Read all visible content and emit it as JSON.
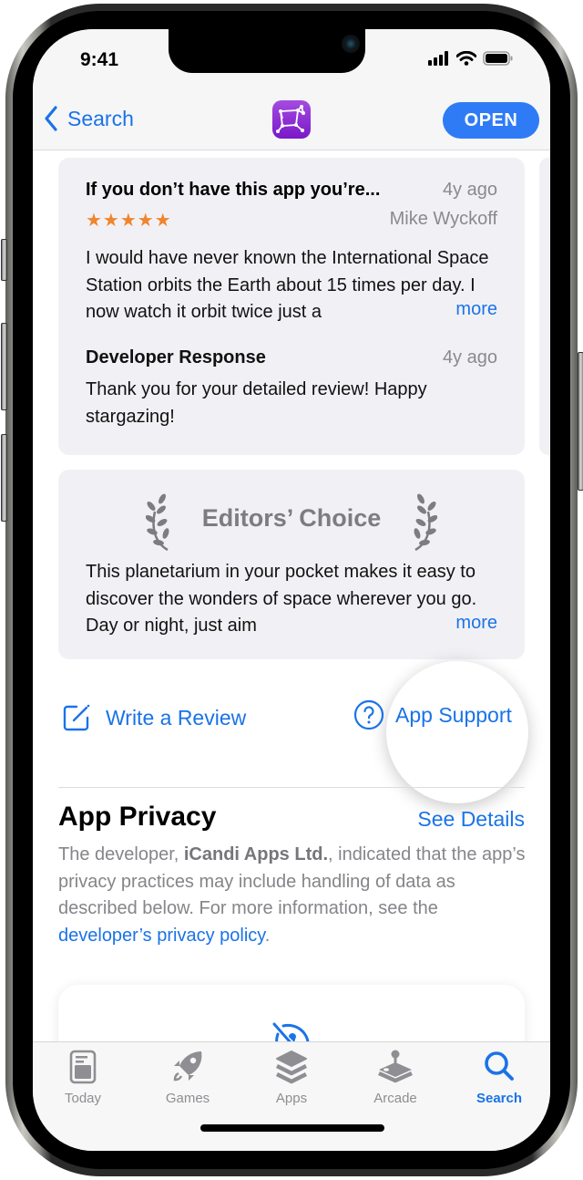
{
  "status_bar": {
    "time": "9:41"
  },
  "nav": {
    "back_label": "Search",
    "app_icon": "sky-guide-constellation-icon",
    "open_label": "OPEN",
    "accent": "#1a73e8",
    "open_color": "#2f7bf5"
  },
  "review": {
    "title": "If you don’t have this app you’re...",
    "date": "4y ago",
    "stars": "★★★★★",
    "rating": 5,
    "author": "Mike Wyckoff",
    "body": "I would have never known the International Space Station orbits the Earth about 15 times per day. I now watch it orbit twice just a",
    "more": "more",
    "developer_response": {
      "title": "Developer Response",
      "date": "4y ago",
      "body": "Thank you for your detailed review!  Happy stargazing!"
    }
  },
  "editors_choice": {
    "title": "Editors’ Choice",
    "body": "This planetarium in your pocket makes it easy to discover the wonders of space wherever you go. Day or night, just aim",
    "more": "more"
  },
  "actions": {
    "write_review": "Write a Review",
    "app_support": "App Support"
  },
  "privacy": {
    "title": "App Privacy",
    "see_details": "See Details",
    "text_before": "The developer, ",
    "developer": "iCandi Apps Ltd.",
    "text_middle": ", indicated that the app’s privacy practices may include handling of data as described below. For more information, see the ",
    "policy_link": "developer’s privacy policy",
    "text_after": ".",
    "card_icon": "data-not-linked-icon"
  },
  "tabs": [
    {
      "label": "Today",
      "icon": "today-icon",
      "active": false
    },
    {
      "label": "Games",
      "icon": "rocket-icon",
      "active": false
    },
    {
      "label": "Apps",
      "icon": "layers-icon",
      "active": false
    },
    {
      "label": "Arcade",
      "icon": "joystick-icon",
      "active": false
    },
    {
      "label": "Search",
      "icon": "search-icon",
      "active": true
    }
  ]
}
